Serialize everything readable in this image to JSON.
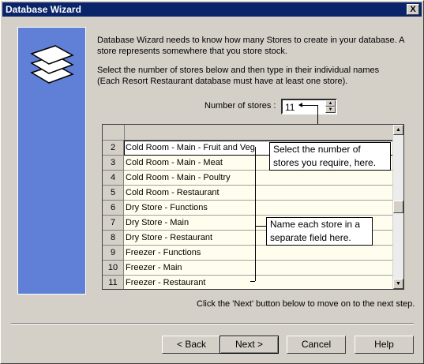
{
  "window": {
    "title": "Database Wizard",
    "close_label": "X"
  },
  "intro": {
    "line1": "Database Wizard needs to know how many Stores to create in your database.  A",
    "line2": "store represents somewhere that you store stock."
  },
  "instructions": {
    "line1": "Select the number of stores below and then type in their individual names",
    "line2": "(Each Resort Restaurant database must have at least one store)."
  },
  "store_count": {
    "label": "Number of stores :",
    "value": "11"
  },
  "stores": [
    {
      "num": "2",
      "name": "Cold Room - Main - Fruit and Veg"
    },
    {
      "num": "3",
      "name": "Cold Room - Main - Meat"
    },
    {
      "num": "4",
      "name": "Cold Room - Main - Poultry"
    },
    {
      "num": "5",
      "name": "Cold Room - Restaurant"
    },
    {
      "num": "6",
      "name": "Dry Store - Functions"
    },
    {
      "num": "7",
      "name": "Dry Store - Main"
    },
    {
      "num": "8",
      "name": "Dry Store - Restaurant"
    },
    {
      "num": "9",
      "name": "Freezer - Functions"
    },
    {
      "num": "10",
      "name": "Freezer - Main"
    },
    {
      "num": "11",
      "name": "Freezer - Restaurant"
    }
  ],
  "callouts": {
    "select": {
      "line1": "Select the number of",
      "line2": "stores you require, here."
    },
    "name": {
      "line1": "Name each store in a",
      "line2": "separate field here."
    }
  },
  "footer_note": "Click the 'Next' button below to move on to the next step.",
  "buttons": {
    "back": "< Back",
    "next": "Next >",
    "cancel": "Cancel",
    "help": "Help"
  },
  "colors": {
    "titlebar": "#0a246a",
    "side_panel": "#5f80d6",
    "grid_cell": "#fffeee",
    "dialog": "#d4d0c8"
  }
}
